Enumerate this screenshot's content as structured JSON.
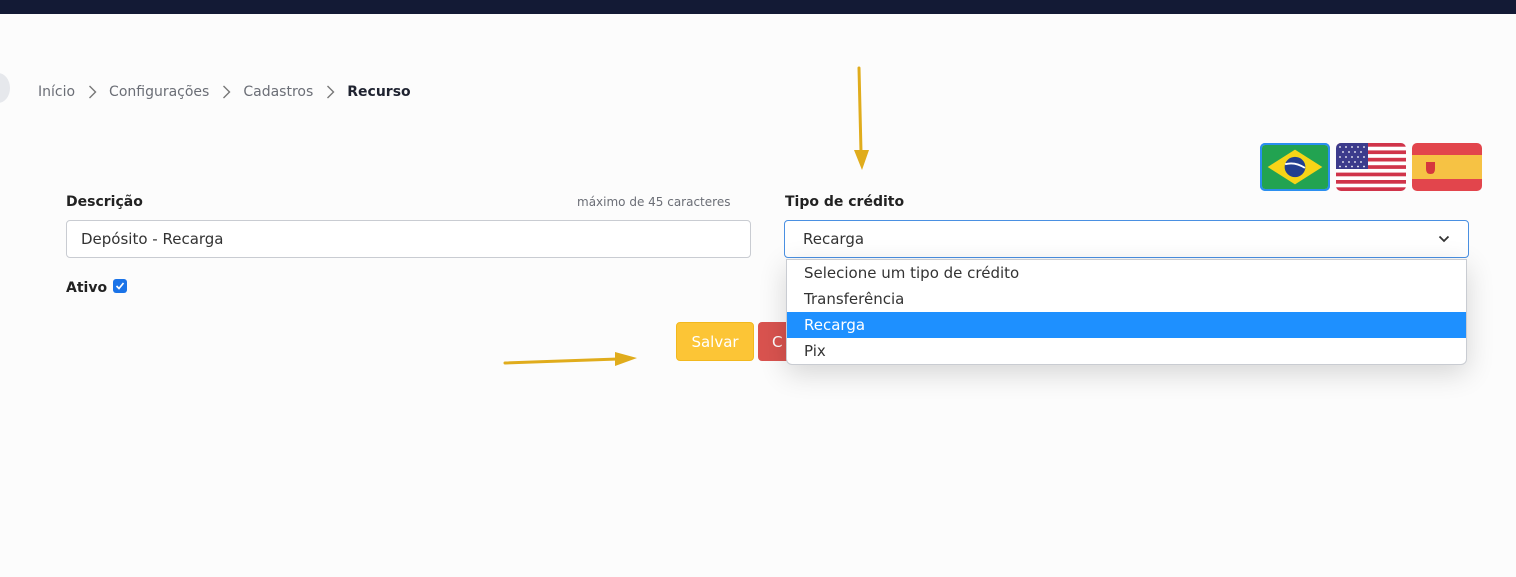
{
  "breadcrumb": {
    "items": [
      "Início",
      "Configurações",
      "Cadastros",
      "Recurso"
    ]
  },
  "languages": [
    {
      "name": "brazil-flag-icon",
      "selected": true
    },
    {
      "name": "usa-flag-icon",
      "selected": false
    },
    {
      "name": "spain-flag-icon",
      "selected": false
    }
  ],
  "form": {
    "descricao_label": "Descrição",
    "descricao_hint": "máximo de 45 caracteres",
    "descricao_value": "Depósito - Recarga",
    "ativo_label": "Ativo",
    "ativo_checked": true,
    "tipo_label": "Tipo de crédito",
    "tipo_value": "Recarga",
    "tipo_options": [
      "Selecione um tipo de crédito",
      "Transferência",
      "Recarga",
      "Pix"
    ],
    "tipo_highlighted": "Recarga"
  },
  "buttons": {
    "save_label": "Salvar",
    "cancel_label": "C"
  },
  "colors": {
    "accent": "#1e90ff",
    "save": "#fcc536",
    "cancel": "#d9534f",
    "topbar": "#131a35",
    "annotation_arrow": "#e0ac1c"
  }
}
